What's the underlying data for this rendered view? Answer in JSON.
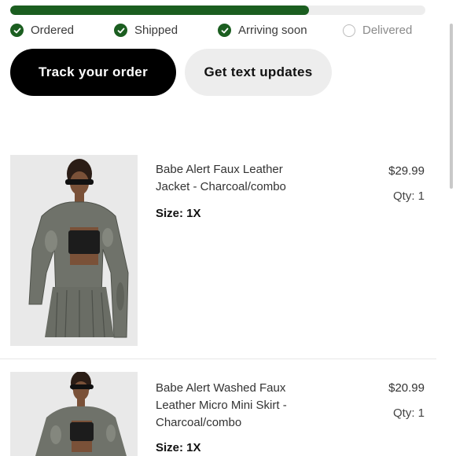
{
  "progress": {
    "fraction": 0.72,
    "fill_color": "#1b5e20"
  },
  "steps": [
    {
      "label": "Ordered",
      "done": true
    },
    {
      "label": "Shipped",
      "done": true
    },
    {
      "label": "Arriving soon",
      "done": true
    },
    {
      "label": "Delivered",
      "done": false
    }
  ],
  "buttons": {
    "track": "Track your order",
    "text_updates": "Get text updates"
  },
  "items": [
    {
      "name": "Babe Alert Faux Leather Jacket - Charcoal/combo",
      "size": "Size: 1X",
      "price": "$29.99",
      "qty": "Qty: 1",
      "image_icon": "product-photo-jacket"
    },
    {
      "name": "Babe Alert Washed Faux Leather Micro Mini Skirt - Charcoal/combo",
      "size": "Size: 1X",
      "price": "$20.99",
      "qty": "Qty: 1",
      "image_icon": "product-photo-skirt"
    }
  ]
}
